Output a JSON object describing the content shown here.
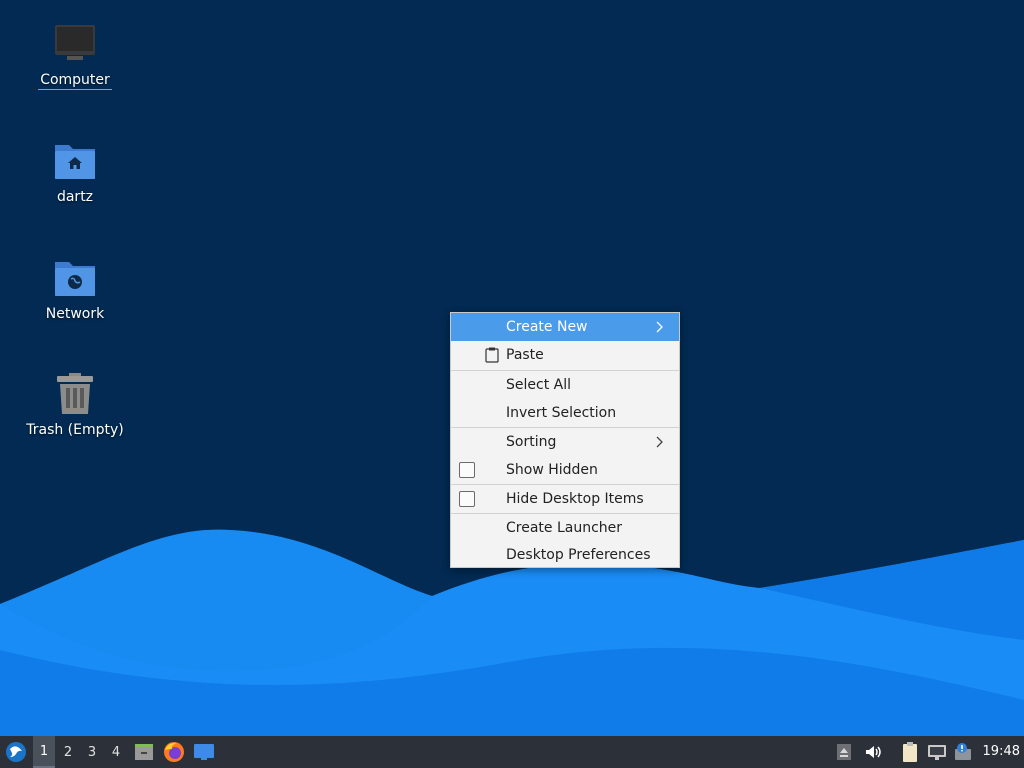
{
  "desktop": {
    "icons": [
      {
        "label": "Computer",
        "icon": "computer-icon"
      },
      {
        "label": "dartz",
        "icon": "home-folder-icon"
      },
      {
        "label": "Network",
        "icon": "network-folder-icon"
      },
      {
        "label": "Trash (Empty)",
        "icon": "trash-icon"
      }
    ]
  },
  "context_menu": {
    "items": [
      {
        "label": "Create New",
        "submenu": true,
        "highlighted": true
      },
      {
        "label": "Paste",
        "icon": "clipboard-icon"
      },
      {
        "label": "Select All"
      },
      {
        "label": "Invert Selection"
      },
      {
        "label": "Sorting",
        "submenu": true
      },
      {
        "label": "Show Hidden",
        "checkbox": true,
        "checked": false
      },
      {
        "label": "Hide Desktop Items",
        "checkbox": true,
        "checked": false
      },
      {
        "label": "Create Launcher"
      },
      {
        "label": "Desktop Preferences"
      }
    ]
  },
  "taskbar": {
    "start_icon": "lxqt-start-icon",
    "workspaces": [
      "1",
      "2",
      "3",
      "4"
    ],
    "active_workspace": "1",
    "launchers": [
      "file-manager-icon",
      "firefox-icon",
      "show-desktop-icon"
    ],
    "tray": [
      "eject-icon",
      "volume-icon",
      "clipboard-icon",
      "network-icon",
      "update-notifier-icon"
    ],
    "clock": "19:48"
  },
  "colors": {
    "desktop_bg": "#022a52",
    "wave_light": "#1e90ff",
    "wave_dark": "#0a6fe0",
    "menu_highlight": "#4a9bea",
    "taskbar_bg": "#2c3038"
  }
}
